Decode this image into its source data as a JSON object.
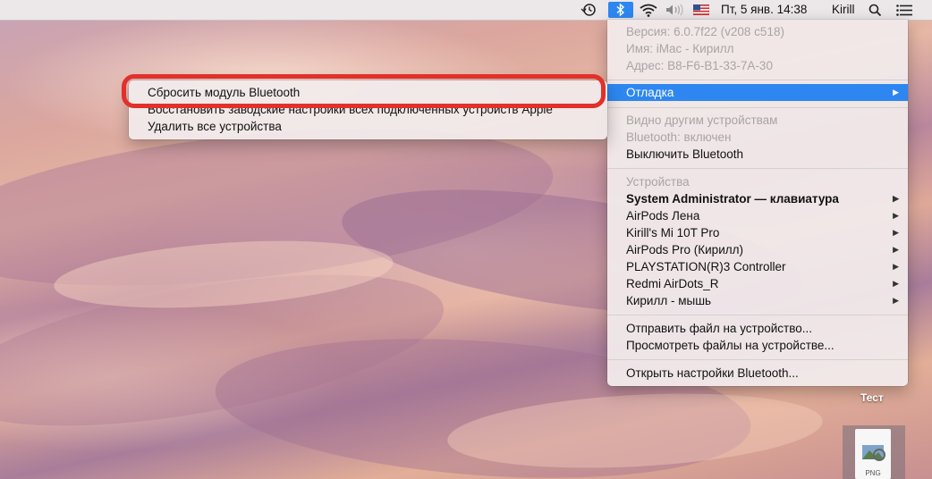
{
  "menubar": {
    "date_time": "Пт, 5 янв.  14:38",
    "user": "Kirill",
    "icons": [
      "time-machine-icon",
      "bluetooth-icon",
      "wifi-icon",
      "volume-icon",
      "flag-us-icon",
      "search-icon",
      "notification-center-icon"
    ]
  },
  "bluetooth_menu": {
    "info": [
      "Версия: 6.0.7f22 (v208 c518)",
      "Имя: iMac - Кирилл",
      "Адрес: B8-F6-B1-33-7A-30"
    ],
    "debug": "Отладка",
    "visible": "Видно другим устройствам",
    "status": "Bluetooth: включен",
    "turn_off": "Выключить Bluetooth",
    "devices_header": "Устройства",
    "devices": [
      "System Administrator — клавиатура",
      "AirPods Лена",
      "Kirill's Mi 10T Pro",
      "AirPods Pro (Кирилл)",
      "PLAYSTATION(R)3 Controller",
      "Redmi AirDots_R",
      "Кирилл - мышь"
    ],
    "send_file": "Отправить файл на устройство...",
    "browse_files": "Просмотреть файлы на устройстве...",
    "open_prefs": "Открыть настройки Bluetooth..."
  },
  "debug_submenu": {
    "reset": "Сбросить модуль Bluetooth",
    "factory_reset": "Восстановить заводские настройки всех подключенных устройств Apple",
    "remove_all": "Удалить все устройства"
  },
  "desktop": {
    "folder_label": "Тест",
    "file_ext": "PNG"
  },
  "colors": {
    "accent": "#2e87f0",
    "highlight_ring": "#e2302a"
  }
}
